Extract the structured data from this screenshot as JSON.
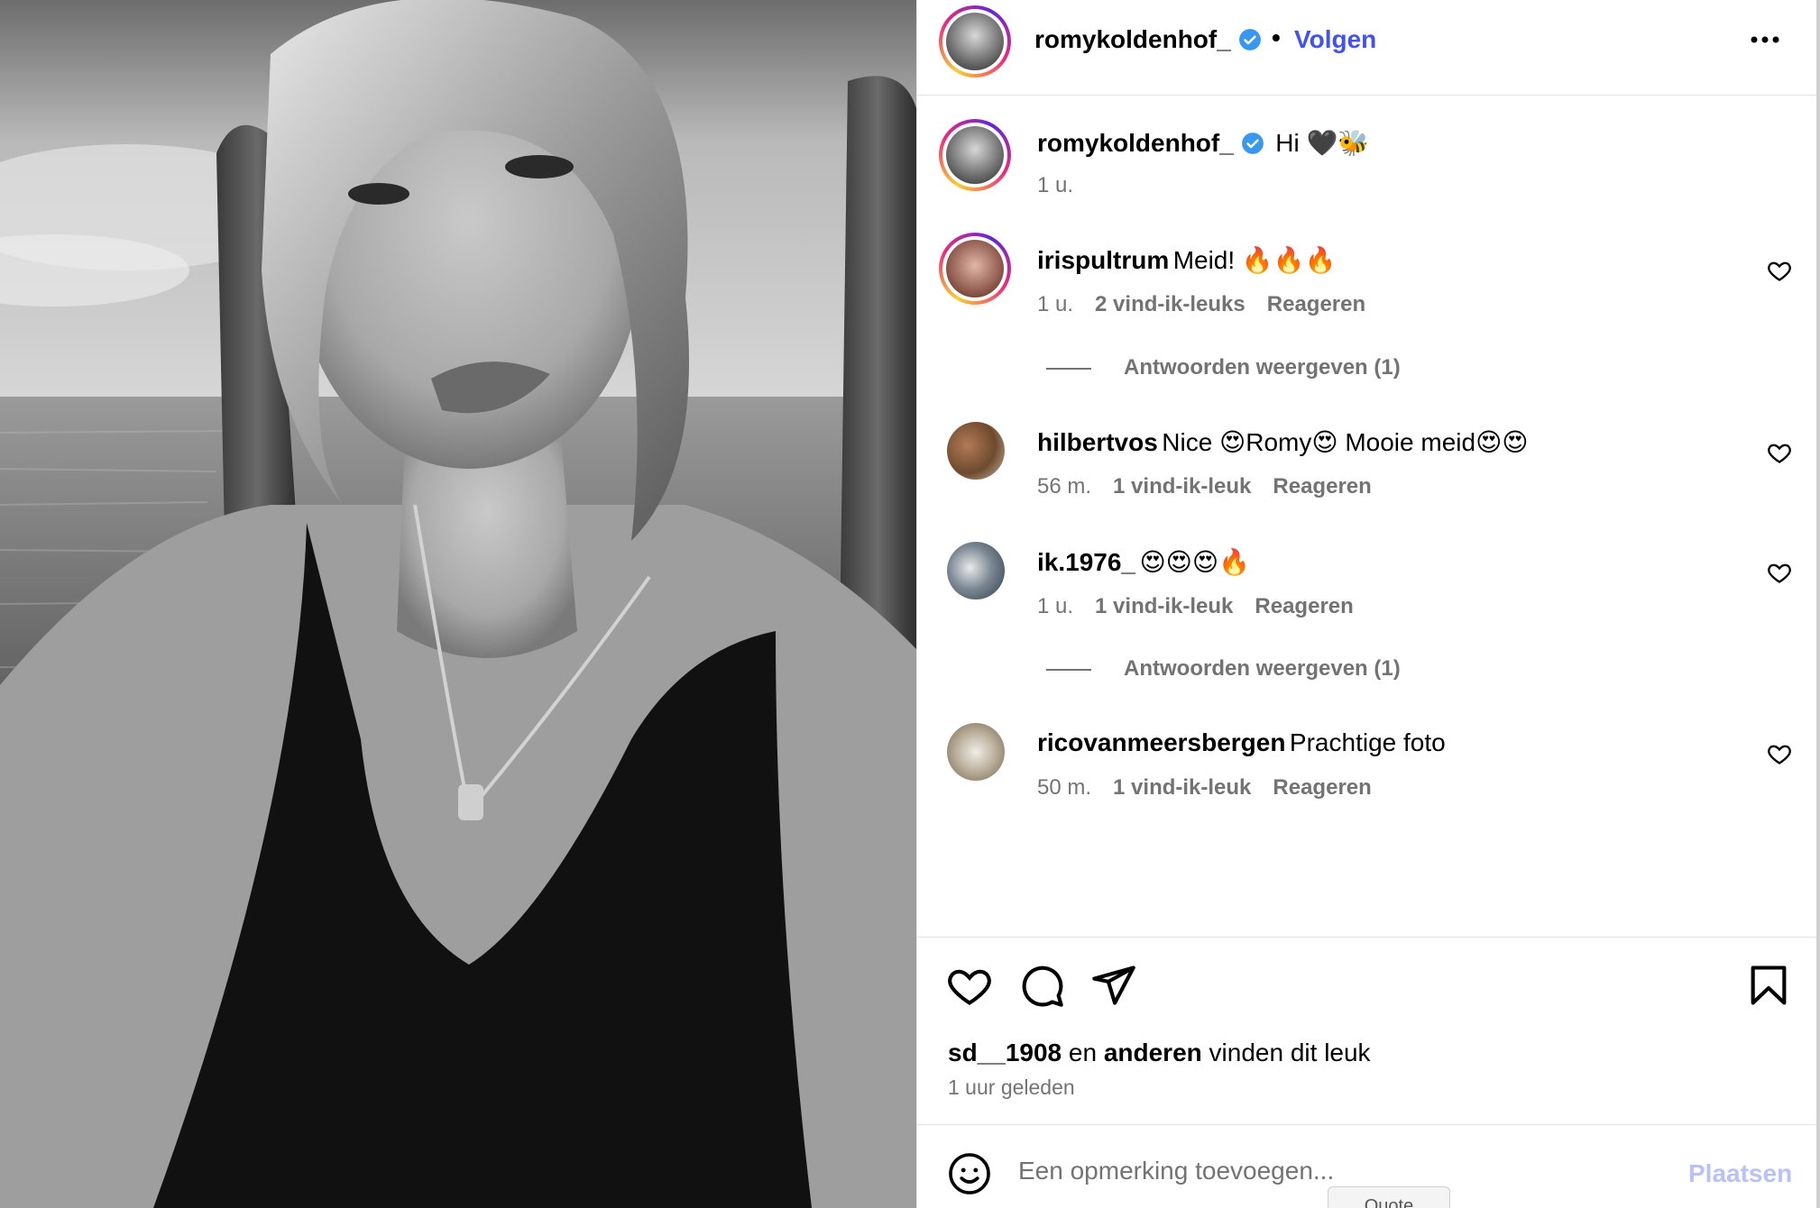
{
  "header": {
    "username": "romykoldenhof_",
    "separator": "•",
    "follow_label": "Volgen",
    "verified_icon": "verified-badge-icon",
    "more_icon": "more-options-icon"
  },
  "caption": {
    "username": "romykoldenhof_",
    "text": "Hi 🖤🐝",
    "time": "1 u."
  },
  "comments": [
    {
      "username": "irispultrum",
      "text": "Meid! 🔥🔥🔥",
      "time": "1 u.",
      "likes": "2 vind-ik-leuks",
      "reply": "Reageren",
      "view_replies": "Antwoorden weergeven (1)"
    },
    {
      "username": "hilbertvos",
      "text": "Nice 😍Romy😍 Mooie meid😍😍",
      "time": "56 m.",
      "likes": "1 vind-ik-leuk",
      "reply": "Reageren"
    },
    {
      "username": "ik.1976_",
      "text": "😍😍😍🔥",
      "time": "1 u.",
      "likes": "1 vind-ik-leuk",
      "reply": "Reageren",
      "view_replies": "Antwoorden weergeven (1)"
    },
    {
      "username": "ricovanmeersbergen",
      "text": "Prachtige foto",
      "time": "50 m.",
      "likes": "1 vind-ik-leuk",
      "reply": "Reageren"
    }
  ],
  "actions": {
    "like_icon": "heart-icon",
    "comment_icon": "comment-icon",
    "share_icon": "share-icon",
    "save_icon": "bookmark-icon"
  },
  "likes_line": {
    "user": "sd__1908",
    "connector": "en",
    "others": "anderen",
    "suffix": "vinden dit leuk"
  },
  "posted_ago": "1 uur geleden",
  "add_comment": {
    "placeholder": "Een opmerking toevoegen...",
    "post_label": "Plaatsen",
    "tooltip": "Quote"
  },
  "colors": {
    "accent": "#4150f7",
    "post_disabled": "#b7c2f8",
    "muted": "#737373",
    "verified": "#3897f0"
  }
}
